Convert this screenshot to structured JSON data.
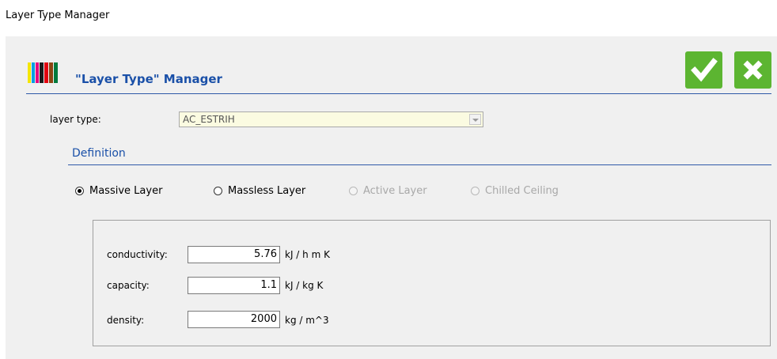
{
  "window": {
    "title": "Layer Type Manager"
  },
  "header": {
    "title": "\"Layer Type\" Manager",
    "logo_colors": [
      "#f5e600",
      "#00a0e3",
      "#e6007e",
      "#1a1a1a",
      "#e3000f",
      "#8b4513",
      "#007a3d"
    ],
    "ok_icon": "checkmark-icon",
    "cancel_icon": "close-icon",
    "accent_color": "#5cb531"
  },
  "layer_type": {
    "label": "layer type:",
    "value": "AC_ESTRIH"
  },
  "definition": {
    "title": "Definition",
    "options": [
      {
        "label": "Massive Layer",
        "checked": true,
        "enabled": true
      },
      {
        "label": "Massless Layer",
        "checked": false,
        "enabled": true
      },
      {
        "label": "Active Layer",
        "checked": false,
        "enabled": false
      },
      {
        "label": "Chilled Ceiling",
        "checked": false,
        "enabled": false
      }
    ]
  },
  "properties": {
    "conductivity": {
      "label": "conductivity:",
      "value": "5.76",
      "unit": "kJ / h m K"
    },
    "capacity": {
      "label": "capacity:",
      "value": "1.1",
      "unit": "kJ / kg K"
    },
    "density": {
      "label": "density:",
      "value": "2000",
      "unit": "kg / m^3"
    }
  }
}
